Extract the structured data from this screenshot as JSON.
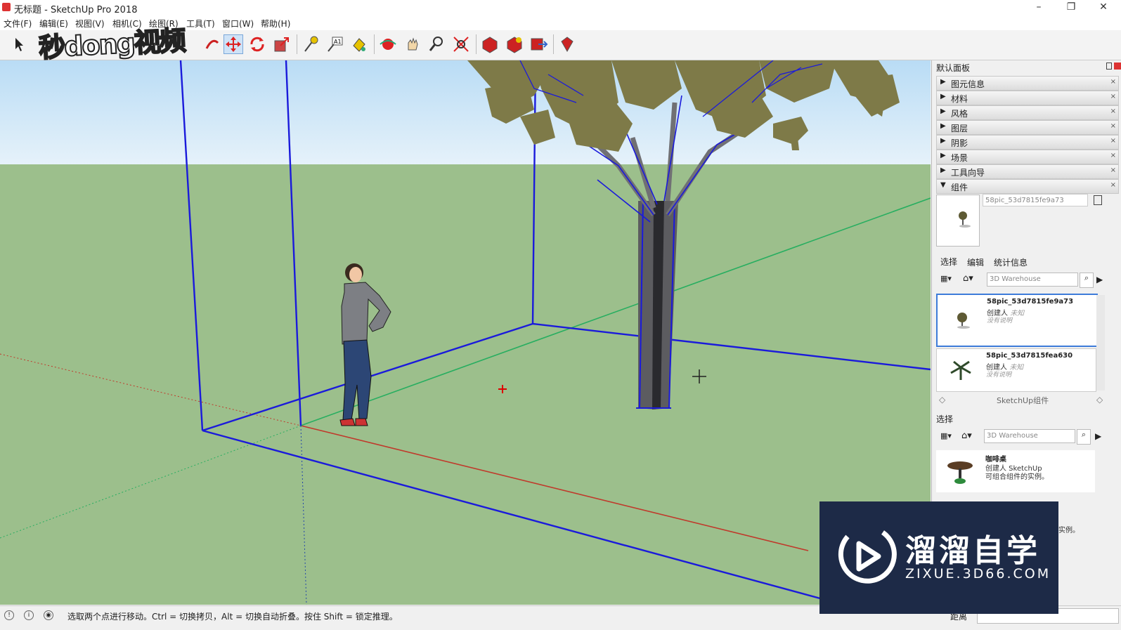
{
  "window": {
    "title": "无标题 - SketchUp Pro 2018",
    "minimize": "–",
    "maximize": "❐",
    "close": "✕"
  },
  "menu": [
    "文件(F)",
    "编辑(E)",
    "视图(V)",
    "相机(C)",
    "绘图(R)",
    "工具(T)",
    "窗口(W)",
    "帮助(H)"
  ],
  "watermark_top": "秒dong视频",
  "tray": {
    "title": "默认面板",
    "rows": [
      "图元信息",
      "材料",
      "风格",
      "图层",
      "阴影",
      "场景",
      "工具向导",
      "组件"
    ],
    "component_name": "58pic_53d7815fe9a73",
    "tabs": [
      "选择",
      "编辑",
      "统计信息"
    ],
    "search_placeholder": "3D Warehouse",
    "items": [
      {
        "name": "58pic_53d7815fe9a73",
        "creator": "创建人",
        "creator_value": "未知",
        "desc": "没有说明"
      },
      {
        "name": "58pic_53d7815fea630",
        "creator": "创建人",
        "creator_value": "未知",
        "desc": "没有说明"
      }
    ],
    "collection_label": "SketchUp组件",
    "select2_label": "选择",
    "search2_placeholder": "3D Warehouse",
    "item3": {
      "name": "咖啡桌",
      "creator": "创建人 SketchUp",
      "desc": "可组合组件的实例。"
    },
    "item3_tail": "件的实例。"
  },
  "status": {
    "hint": "选取两个点进行移动。Ctrl = 切换拷贝，Alt = 切换自动折叠。按住 Shift = 锁定推理。",
    "distance_label": "距离"
  },
  "watermark_bottom": {
    "cn": "溜溜自学",
    "url": "ZIXUE.3D66.COM"
  },
  "colors": {
    "ground": "#9cbf8c",
    "axis_red": "#c0392b",
    "axis_green": "#27ae60",
    "selection_blue": "#1a1adb"
  }
}
